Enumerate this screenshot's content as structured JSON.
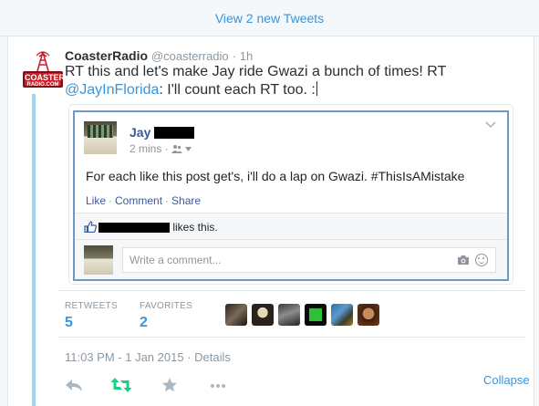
{
  "banner": {
    "label": "View 2 new Tweets"
  },
  "tweet": {
    "logo_text_top": "COASTER",
    "logo_text_bottom": "RADIO.COM",
    "fullname": "CoasterRadio",
    "username": "@coasterradio",
    "separator": "·",
    "age": "1h",
    "text_part1": "RT this and let's make Jay ride Gwazi a bunch of times! RT ",
    "mention": "@JayInFlorida",
    "text_part2": ": I'll count each RT too. :",
    "date": "11:03 PM - 1 Jan 2015",
    "date_sep": "·",
    "details_label": "Details",
    "collapse_label": "Collapse"
  },
  "embed": {
    "author_name": "Jay",
    "time": "2 mins",
    "meta_sep": "·",
    "post_text": "For each like this post get's, i'll do a lap on Gwazi. #ThisIsAMistake",
    "actions": {
      "like": "Like",
      "sep": "·",
      "comment": "Comment",
      "share": "Share"
    },
    "likes_suffix": "likes this.",
    "comment_placeholder": "Write a comment..."
  },
  "stats": {
    "retweets_label": "RETWEETS",
    "retweets_count": "5",
    "favorites_label": "FAVORITES",
    "favorites_count": "2"
  },
  "colors": {
    "link": "#3b94d9",
    "muted": "#8899a6",
    "text": "#292f33",
    "facebook_blue": "#3b5998",
    "retweet_green": "#19cf86",
    "thread_line": "#9fd5f0"
  },
  "icons": [
    "coasterradio-logo",
    "caret-down-icon",
    "friends-icon",
    "chevron-down-icon",
    "thumbs-up-icon",
    "camera-icon",
    "smiley-icon",
    "reply-icon",
    "retweet-icon",
    "favorite-icon",
    "more-icon"
  ]
}
